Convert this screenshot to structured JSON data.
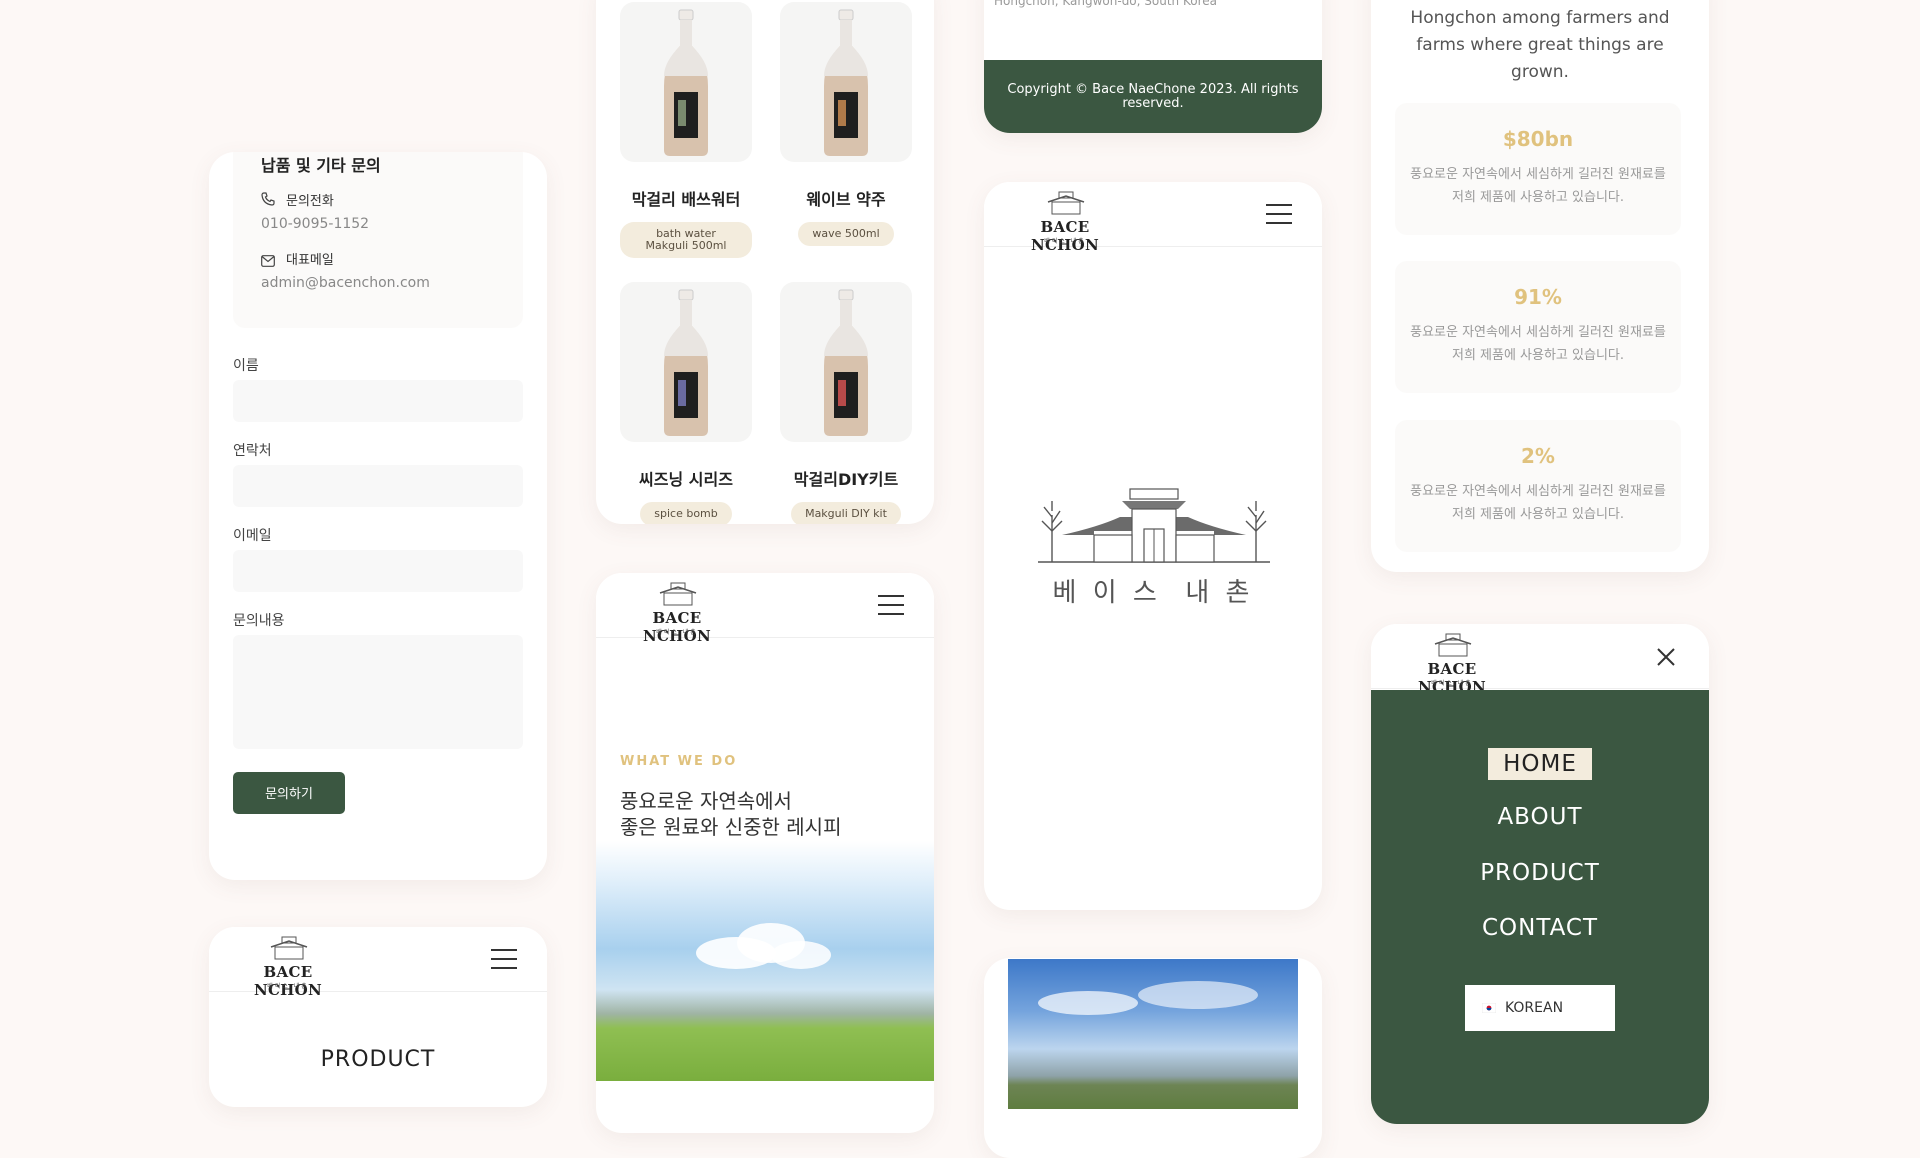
{
  "contact_card": {
    "inquiry_title": "납품 및 기타 문의",
    "phone_label": "문의전화",
    "phone_value": "010-9095-1152",
    "email_label": "대표메일",
    "email_value": "admin@bacenchon.com",
    "name_label": "이름",
    "contact_label": "연락처",
    "email_field_label": "이메일",
    "message_label": "문의내용",
    "submit_label": "문의하기"
  },
  "logo": {
    "word": "BACE NCHON",
    "sub": "베이스 내촌"
  },
  "product_header_card": {
    "section_title": "PRODUCT"
  },
  "products_card": {
    "items": [
      {
        "name": "막걸리 배쓰워터",
        "tag": "bath water Makguli 500ml"
      },
      {
        "name": "웨이브 약주",
        "tag": "wave 500ml"
      },
      {
        "name": "씨즈닝 시리즈",
        "tag": "spice bomb"
      },
      {
        "name": "막걸리DIY키트",
        "tag": "Makguli DIY kit"
      }
    ]
  },
  "whatwedo_card": {
    "eyebrow": "WHAT WE DO",
    "headline_line1": "풍요로운 자연속에서",
    "headline_line2": "좋은 원료와 신중한 레시피"
  },
  "footer_card": {
    "address": "Hongchon, Kangwon-do, South Korea",
    "copyright": "Copyright © Bace NaeChone 2023. All rights reserved."
  },
  "splash_card": {
    "brand_korean": "베 이 스  내 촌"
  },
  "stats_card": {
    "intro": "Hongchon among farmers and farms where great things are grown.",
    "stats": [
      {
        "value": "$80bn",
        "desc": "풍요로운 자연속에서 세심하게 길러진 원재료를 저희 제품에 사용하고 있습니다."
      },
      {
        "value": "91%",
        "desc": "풍요로운 자연속에서 세심하게 길러진 원재료를 저희 제품에 사용하고 있습니다."
      },
      {
        "value": "2%",
        "desc": "풍요로운 자연속에서 세심하게 길러진 원재료를 저희 제품에 사용하고 있습니다."
      }
    ]
  },
  "menu_card": {
    "items": [
      "HOME",
      "ABOUT",
      "PRODUCT",
      "CONTACT"
    ],
    "language_label": "KOREAN"
  },
  "colors": {
    "brand_green": "#3b5741",
    "accent_gold": "#e0c27e",
    "pill_cream": "#f3ecdd"
  }
}
